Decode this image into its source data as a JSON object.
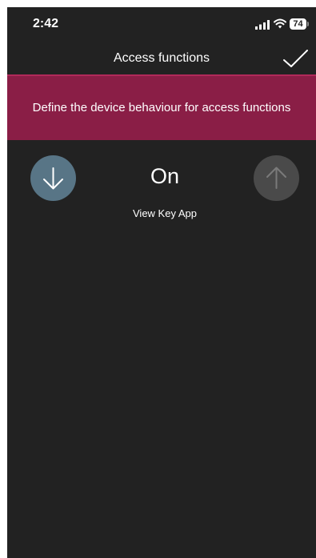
{
  "status_bar": {
    "time": "2:42",
    "battery_level": "74",
    "icons": [
      "signal-icon",
      "wifi-icon",
      "battery-icon"
    ]
  },
  "nav": {
    "title": "Access functions",
    "confirm_icon": "checkmark-icon"
  },
  "banner": {
    "text": "Define the device behaviour for access functions",
    "color": "#8a1e46"
  },
  "selector": {
    "value": "On",
    "sublabel": "View Key App",
    "prev_icon": "arrow-down-icon",
    "next_icon": "arrow-up-icon",
    "prev_color": "#587586",
    "next_color": "#4a4a4a"
  },
  "colors": {
    "background": "#222222",
    "text": "#ffffff"
  }
}
